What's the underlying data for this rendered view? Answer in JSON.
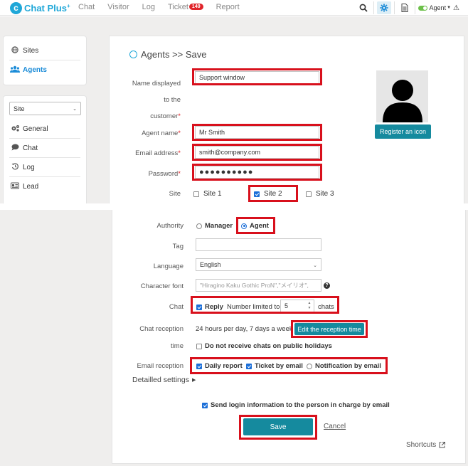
{
  "app": {
    "logo_text": "Chat Plus",
    "logo_plus": "+",
    "nav": [
      "Chat",
      "Visitor",
      "Log"
    ],
    "nav_ticket": "Ticket",
    "ticket_badge": "149",
    "nav_report": "Report",
    "agent_status": "Agent"
  },
  "sidebar": {
    "sites_label": "Sites",
    "agents_label": "Agents",
    "site_select": "Site",
    "menu": [
      "General",
      "Chat",
      "Log",
      "Lead"
    ]
  },
  "page": {
    "title": "Agents >> Save"
  },
  "form": {
    "name_label_1": "Name displayed",
    "name_label_2": "to the",
    "name_label_3": "customer",
    "name_value": "Support window",
    "agent_name_label": "Agent name",
    "agent_name_value": "Mr Smith",
    "email_label": "Email address",
    "email_value": "smith@company.com",
    "password_label": "Password",
    "password_value": "●●●●●●●●●●",
    "site_label": "Site",
    "sites": [
      "Site 1",
      "Site 2",
      "Site 3"
    ],
    "sites_checked": [
      false,
      true,
      false
    ],
    "register_icon_label": "Register an icon",
    "authority_label": "Authority",
    "authority_options": [
      "Manager",
      "Agent"
    ],
    "authority_selected": "Agent",
    "tag_label": "Tag",
    "tag_value": "",
    "language_label": "Language",
    "language_value": "English",
    "font_label": "Character font",
    "font_placeholder": "\"Hiragino Kaku Gothic ProN\",\"メイリオ\",",
    "chat_label": "Chat",
    "reply_label": "Reply",
    "limit_label": "Number limited to",
    "limit_value": "5",
    "limit_unit": "chats",
    "reception_label_1": "Chat reception",
    "reception_label_2": "time",
    "reception_value": "24 hours per day, 7 days a week",
    "edit_reception_label": "Edit the reception time",
    "holiday_label": "Do not receive chats on public holidays",
    "email_reception_label": "Email reception",
    "email_reception_options": [
      "Daily report",
      "Ticket by email",
      "Notification by email"
    ],
    "email_reception_checked": [
      true,
      true,
      false
    ],
    "detailed_settings": "Detailled settings",
    "send_login_label": "Send login information to the person in charge by email",
    "save_label": "Save",
    "cancel_label": "Cancel",
    "shortcuts_label": "Shortcuts"
  },
  "colors": {
    "brand": "#1fa7d8",
    "teal_button": "#158a9e",
    "highlight": "#d8101c",
    "badge": "#e0242a"
  }
}
